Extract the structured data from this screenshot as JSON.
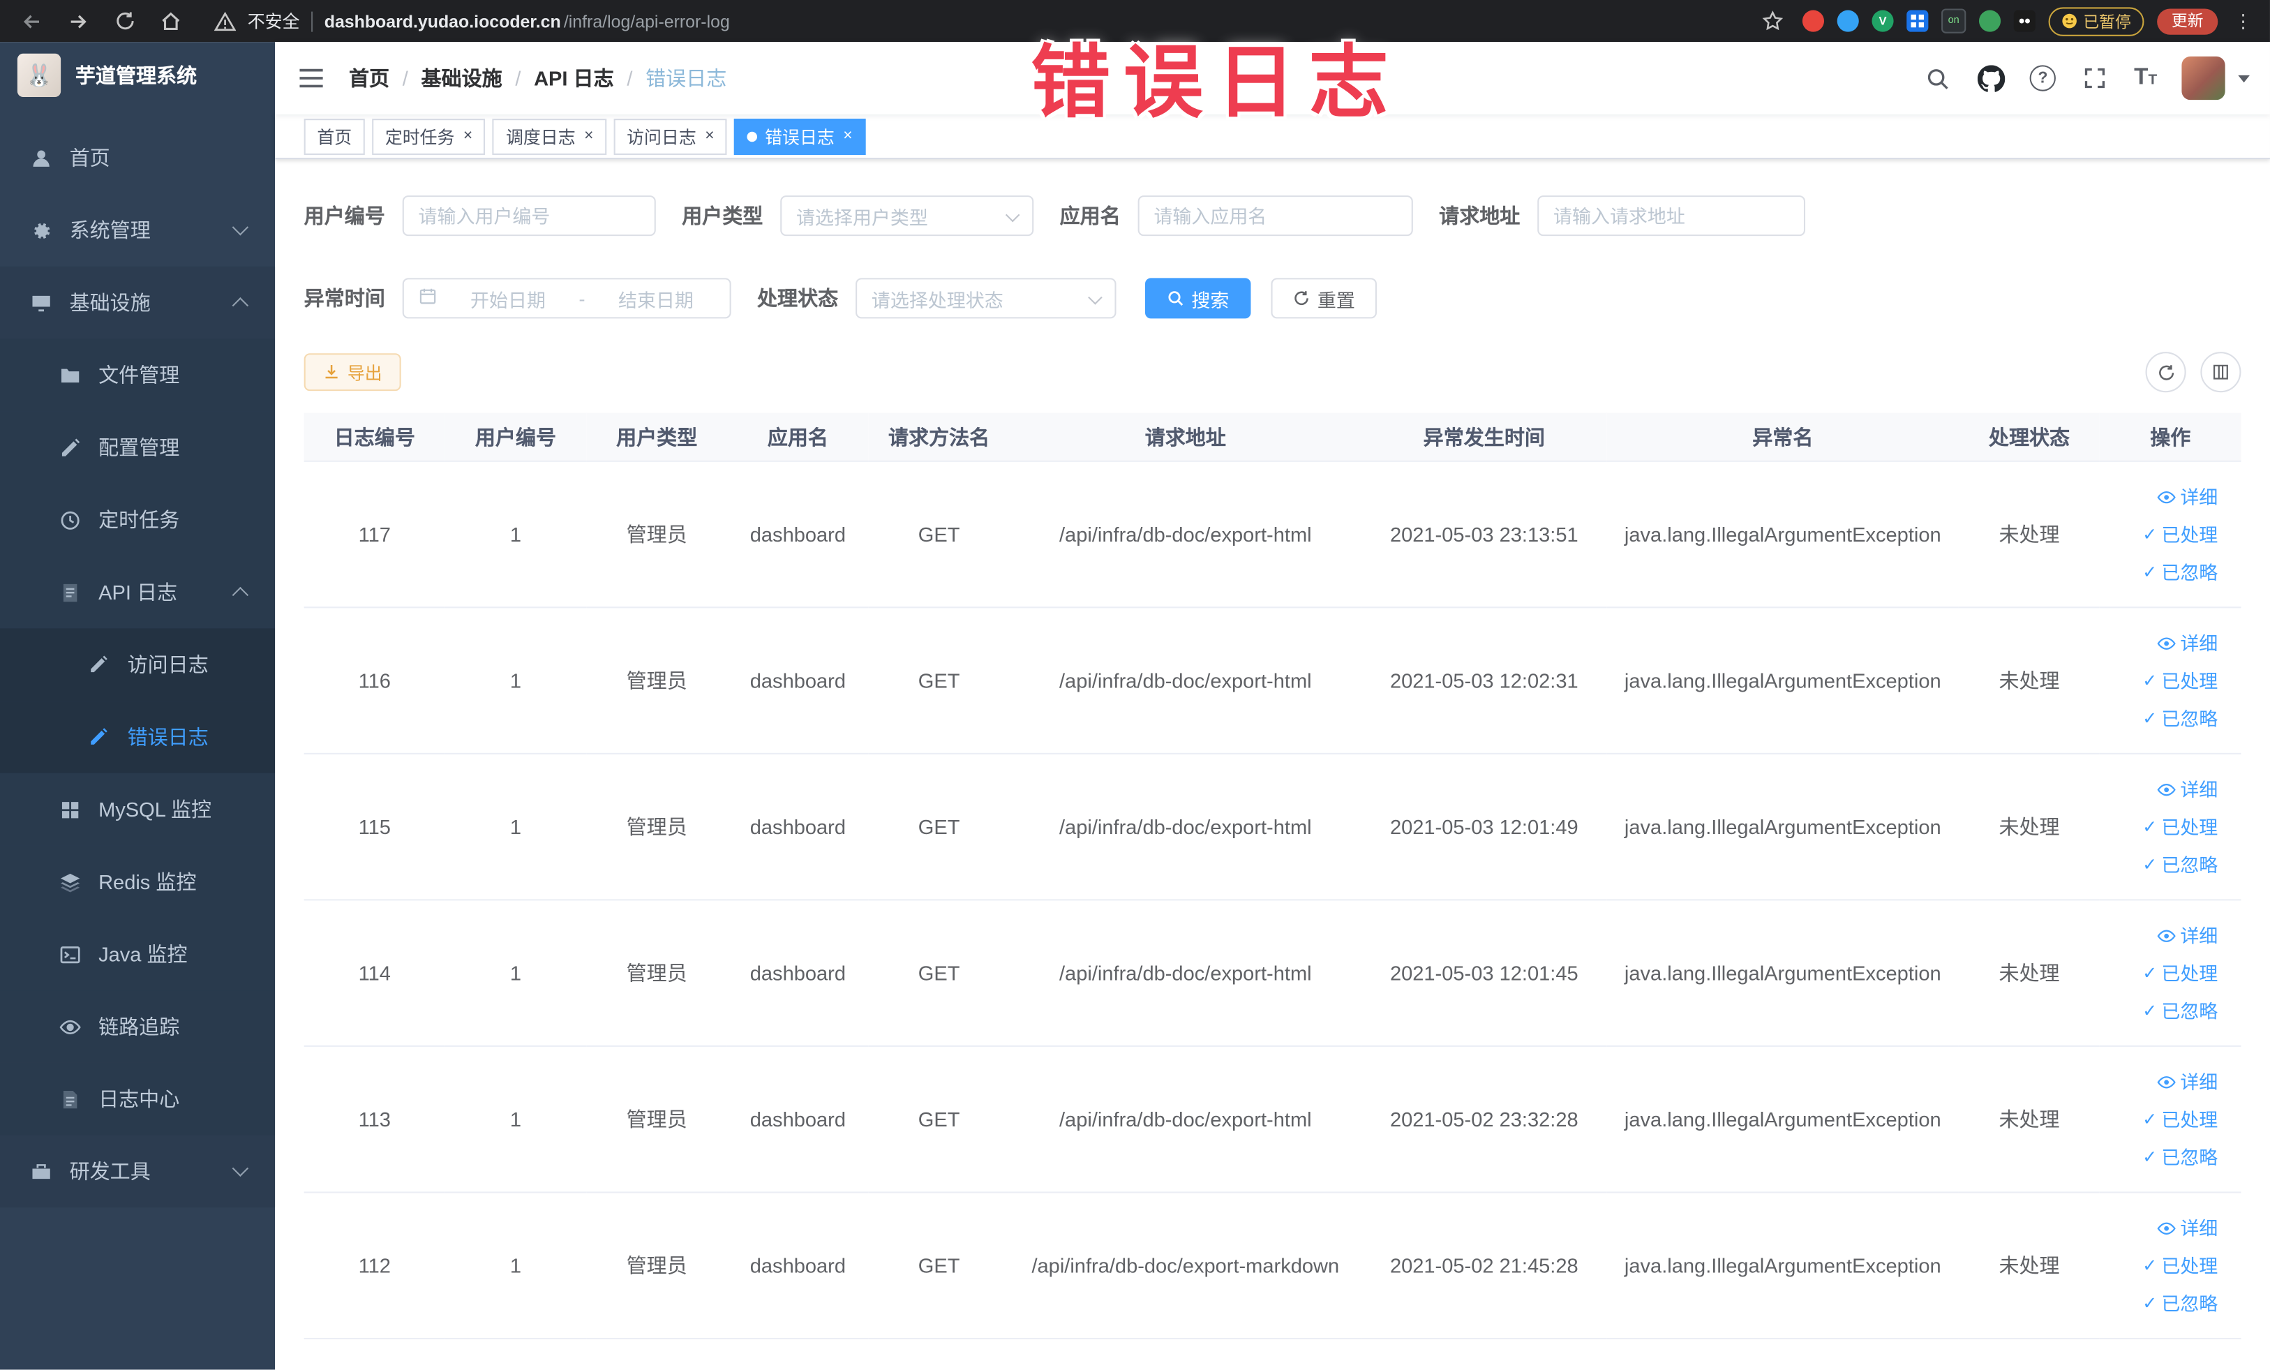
{
  "colors": {
    "accent": "#409eff",
    "sidebar_bg": "#304156",
    "active_tab": "#409eff",
    "warning": "#e6a23c",
    "watermark_red": "#ee3d50"
  },
  "watermark": "错误日志",
  "browser": {
    "insecure_label": "不安全",
    "url_domain": "dashboard.yudao.iocoder.cn",
    "url_path": "/infra/log/api-error-log",
    "extension_badge": "on",
    "paused_badge": "已暂停",
    "update_button": "更新"
  },
  "sidebar": {
    "logo_title": "芋道管理系统",
    "items": [
      {
        "label": "首页"
      },
      {
        "label": "系统管理"
      },
      {
        "label": "基础设施"
      },
      {
        "label": "文件管理"
      },
      {
        "label": "配置管理"
      },
      {
        "label": "定时任务"
      },
      {
        "label": "API 日志"
      },
      {
        "label": "访问日志"
      },
      {
        "label": "错误日志"
      },
      {
        "label": "MySQL 监控"
      },
      {
        "label": "Redis 监控"
      },
      {
        "label": "Java 监控"
      },
      {
        "label": "链路追踪"
      },
      {
        "label": "日志中心"
      },
      {
        "label": "研发工具"
      }
    ]
  },
  "breadcrumb": {
    "separator": "/",
    "items": [
      "首页",
      "基础设施",
      "API 日志",
      "错误日志"
    ]
  },
  "tabs": [
    {
      "label": "首页"
    },
    {
      "label": "定时任务"
    },
    {
      "label": "调度日志"
    },
    {
      "label": "访问日志"
    },
    {
      "label": "错误日志"
    }
  ],
  "filters": {
    "user_id_label": "用户编号",
    "user_id_placeholder": "请输入用户编号",
    "user_type_label": "用户类型",
    "user_type_placeholder": "请选择用户类型",
    "app_name_label": "应用名",
    "app_name_placeholder": "请输入应用名",
    "request_url_label": "请求地址",
    "request_url_placeholder": "请输入请求地址",
    "exception_time_label": "异常时间",
    "start_date_placeholder": "开始日期",
    "end_date_placeholder": "结束日期",
    "range_separator": "-",
    "process_status_label": "处理状态",
    "process_status_placeholder": "请选择处理状态",
    "search_button": "搜索",
    "reset_button": "重置"
  },
  "toolbar": {
    "export_button": "导出"
  },
  "table": {
    "headers": [
      "日志编号",
      "用户编号",
      "用户类型",
      "应用名",
      "请求方法名",
      "请求地址",
      "异常发生时间",
      "异常名",
      "处理状态",
      "操作"
    ],
    "action_labels": {
      "detail": "详细",
      "processed": "已处理",
      "ignored": "已忽略"
    },
    "rows": [
      {
        "id": "117",
        "user_id": "1",
        "user_type": "管理员",
        "app_name": "dashboard",
        "method": "GET",
        "url": "/api/infra/db-doc/export-html",
        "time": "2021-05-03 23:13:51",
        "exception": "java.lang.IllegalArgumentException",
        "status": "未处理"
      },
      {
        "id": "116",
        "user_id": "1",
        "user_type": "管理员",
        "app_name": "dashboard",
        "method": "GET",
        "url": "/api/infra/db-doc/export-html",
        "time": "2021-05-03 12:02:31",
        "exception": "java.lang.IllegalArgumentException",
        "status": "未处理"
      },
      {
        "id": "115",
        "user_id": "1",
        "user_type": "管理员",
        "app_name": "dashboard",
        "method": "GET",
        "url": "/api/infra/db-doc/export-html",
        "time": "2021-05-03 12:01:49",
        "exception": "java.lang.IllegalArgumentException",
        "status": "未处理"
      },
      {
        "id": "114",
        "user_id": "1",
        "user_type": "管理员",
        "app_name": "dashboard",
        "method": "GET",
        "url": "/api/infra/db-doc/export-html",
        "time": "2021-05-03 12:01:45",
        "exception": "java.lang.IllegalArgumentException",
        "status": "未处理"
      },
      {
        "id": "113",
        "user_id": "1",
        "user_type": "管理员",
        "app_name": "dashboard",
        "method": "GET",
        "url": "/api/infra/db-doc/export-html",
        "time": "2021-05-02 23:32:28",
        "exception": "java.lang.IllegalArgumentException",
        "status": "未处理"
      },
      {
        "id": "112",
        "user_id": "1",
        "user_type": "管理员",
        "app_name": "dashboard",
        "method": "GET",
        "url": "/api/infra/db-doc/export-markdown",
        "time": "2021-05-02 21:45:28",
        "exception": "java.lang.IllegalArgumentException",
        "status": "未处理"
      }
    ]
  }
}
